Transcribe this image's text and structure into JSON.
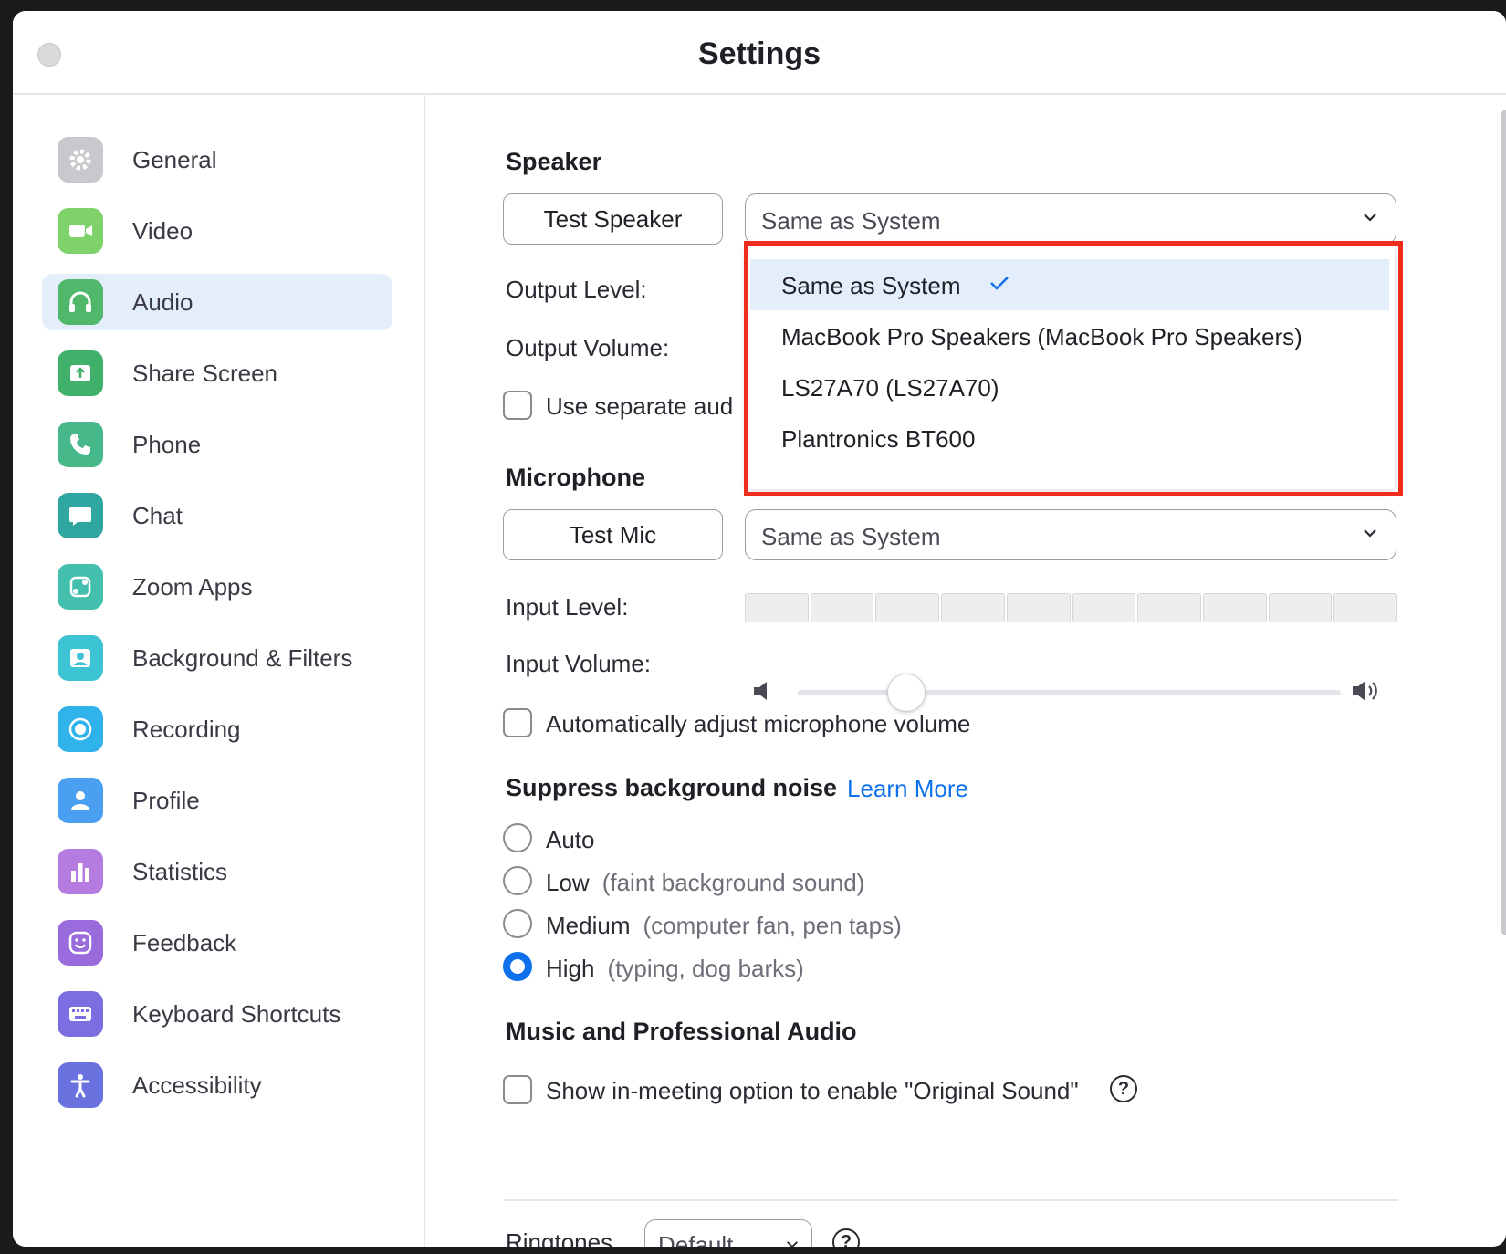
{
  "window": {
    "title": "Settings"
  },
  "sidebar": {
    "items": [
      {
        "label": "General",
        "icon": "gear-icon",
        "color": "#c9c9cd",
        "active": false
      },
      {
        "label": "Video",
        "icon": "video-camera-icon",
        "color": "#7fd16a",
        "active": false
      },
      {
        "label": "Audio",
        "icon": "headphones-icon",
        "color": "#4fb86a",
        "active": true
      },
      {
        "label": "Share Screen",
        "icon": "share-screen-icon",
        "color": "#3fb16a",
        "active": false
      },
      {
        "label": "Phone",
        "icon": "phone-icon",
        "color": "#47b88a",
        "active": false
      },
      {
        "label": "Chat",
        "icon": "chat-bubble-icon",
        "color": "#2fa7a0",
        "active": false
      },
      {
        "label": "Zoom Apps",
        "icon": "zoom-apps-icon",
        "color": "#43bfae",
        "active": false
      },
      {
        "label": "Background & Filters",
        "icon": "person-background-icon",
        "color": "#3cc4d4",
        "active": false
      },
      {
        "label": "Recording",
        "icon": "record-icon",
        "color": "#2fb3ea",
        "active": false
      },
      {
        "label": "Profile",
        "icon": "profile-icon",
        "color": "#4a9ff0",
        "active": false
      },
      {
        "label": "Statistics",
        "icon": "bar-chart-icon",
        "color": "#b57be0",
        "active": false
      },
      {
        "label": "Feedback",
        "icon": "smile-icon",
        "color": "#9a6bdc",
        "active": false
      },
      {
        "label": "Keyboard Shortcuts",
        "icon": "keyboard-icon",
        "color": "#7b6ee0",
        "active": false
      },
      {
        "label": "Accessibility",
        "icon": "accessibility-icon",
        "color": "#6a72e0",
        "active": false
      }
    ]
  },
  "speaker": {
    "section_title": "Speaker",
    "test_button": "Test Speaker",
    "selected": "Same as System",
    "output_level_label": "Output Level:",
    "output_volume_label": "Output Volume:",
    "separate_device_label": "Use separate aud",
    "dropdown_options": [
      {
        "label": "Same as System",
        "selected": true
      },
      {
        "label": "MacBook Pro Speakers (MacBook Pro Speakers)",
        "selected": false
      },
      {
        "label": "LS27A70 (LS27A70)",
        "selected": false
      },
      {
        "label": "Plantronics BT600",
        "selected": false
      }
    ]
  },
  "microphone": {
    "section_title": "Microphone",
    "test_button": "Test Mic",
    "selected": "Same as System",
    "input_level_label": "Input Level:",
    "input_volume_label": "Input Volume:",
    "input_volume_fraction": 0.2,
    "level_segments": 10,
    "auto_adjust_label": "Automatically adjust microphone volume",
    "auto_adjust_checked": false
  },
  "noise": {
    "section_title": "Suppress background noise",
    "learn_more": "Learn More",
    "options": [
      {
        "label": "Auto",
        "hint": "",
        "checked": false
      },
      {
        "label": "Low",
        "hint": "(faint background sound)",
        "checked": false
      },
      {
        "label": "Medium",
        "hint": "(computer fan, pen taps)",
        "checked": false
      },
      {
        "label": "High",
        "hint": "(typing, dog barks)",
        "checked": true
      }
    ]
  },
  "music": {
    "section_title": "Music and Professional Audio",
    "original_sound_label": "Show in-meeting option to enable \"Original Sound\"",
    "help": "?"
  },
  "ringtones": {
    "label": "Ringtones",
    "selected": "Default",
    "help": "?"
  },
  "colors": {
    "accent": "#0e71eb",
    "highlight": "#ef2d1c",
    "active_nav": "#e4eefb"
  }
}
